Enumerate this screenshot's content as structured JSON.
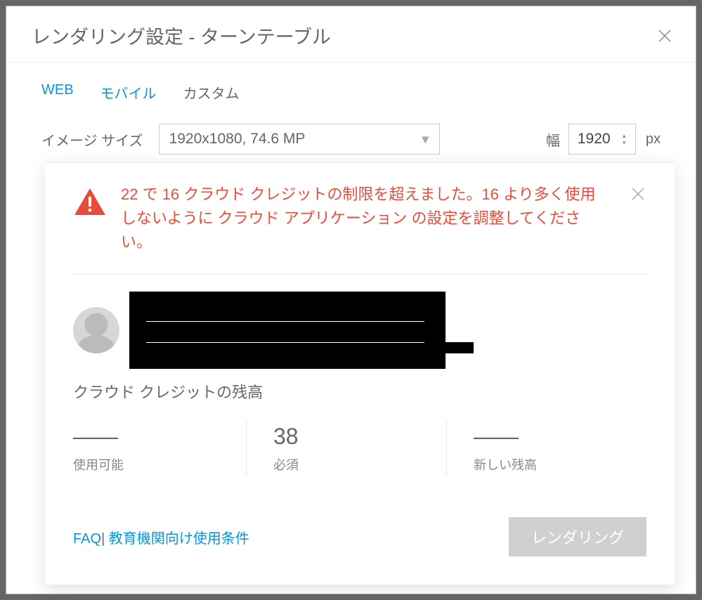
{
  "dialog": {
    "title": "レンダリング設定 - ターンテーブル"
  },
  "tabs": {
    "web": "WEB",
    "mobile": "モバイル",
    "custom": "カスタム"
  },
  "imageSize": {
    "label": "イメージ サイズ",
    "value": "1920x1080, 74.6 MP"
  },
  "width": {
    "label": "幅",
    "value": "1920",
    "unit": "px"
  },
  "warning": {
    "message": "22 で 16 クラウド クレジットの制限を超えました。16 より多く使用しないように クラウド アプリケーション の設定を調整してください。"
  },
  "balance": {
    "title": "クラウド クレジットの残高"
  },
  "stats": {
    "available": {
      "value": "——",
      "label": "使用可能"
    },
    "required": {
      "value": "38",
      "label": "必須"
    },
    "newBalance": {
      "value": "——",
      "label": "新しい残高"
    }
  },
  "links": {
    "faq": "FAQ",
    "separator": "|",
    "terms": "教育機関向け使用条件"
  },
  "actions": {
    "render": "レンダリング"
  }
}
